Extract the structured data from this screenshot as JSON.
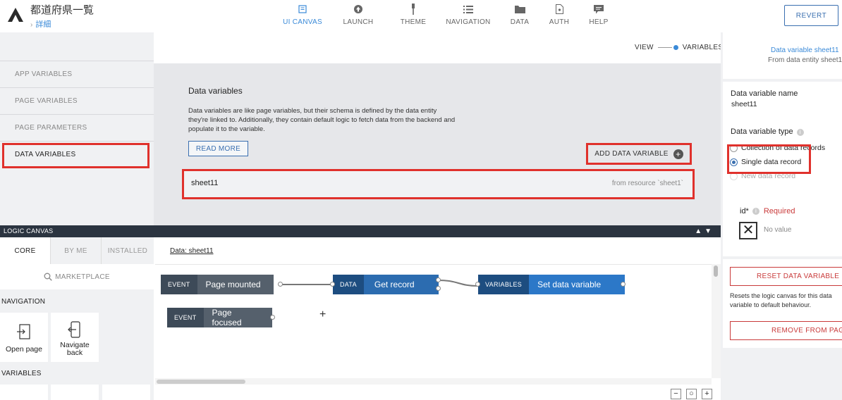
{
  "app": {
    "title": "都道府県一覧",
    "breadcrumb": "詳細"
  },
  "topnav": [
    {
      "label": "UI CANVAS",
      "icon": "ui-canvas-icon",
      "active": true
    },
    {
      "label": "LAUNCH",
      "icon": "launch-icon",
      "active": false
    },
    {
      "label": "THEME",
      "icon": "theme-brush-icon",
      "active": false
    },
    {
      "label": "NAVIGATION",
      "icon": "navigation-list-icon",
      "active": false
    },
    {
      "label": "DATA",
      "icon": "folder-icon",
      "active": false
    },
    {
      "label": "AUTH",
      "icon": "auth-document-icon",
      "active": false
    },
    {
      "label": "HELP",
      "icon": "help-chat-icon",
      "active": false
    }
  ],
  "revert_label": "REVERT",
  "left_menu": [
    {
      "label": "APP VARIABLES"
    },
    {
      "label": "PAGE VARIABLES"
    },
    {
      "label": "PAGE PARAMETERS"
    },
    {
      "label": "DATA VARIABLES",
      "active": true
    }
  ],
  "view_toggle": {
    "left": "VIEW",
    "right": "VARIABLES"
  },
  "data_variables": {
    "title": "Data variables",
    "description": "Data variables are like page variables, but their schema is defined by the data entity they're linked to. Additionally, they contain default logic to fetch data from the backend and populate it to the variable.",
    "read_more": "READ MORE",
    "add_label": "ADD DATA VARIABLE",
    "items": [
      {
        "name": "sheet11",
        "source": "from resource `sheet1`"
      }
    ]
  },
  "logic_canvas": {
    "header": "LOGIC CANVAS",
    "tabs": [
      "CORE",
      "BY ME",
      "INSTALLED"
    ],
    "marketplace": "MARKETPLACE",
    "section_navigation": "NAVIGATION",
    "section_variables": "VARIABLES",
    "tiles": [
      {
        "label": "Open page",
        "icon": "open-page-icon"
      },
      {
        "label": "Navigate back",
        "icon": "navigate-back-icon"
      }
    ],
    "context_link": "Data: sheet11",
    "nodes": [
      {
        "kind": "EVENT",
        "title": "Page mounted"
      },
      {
        "kind": "DATA",
        "title": "Get record"
      },
      {
        "kind": "VARIABLES",
        "title": "Set data variable"
      },
      {
        "kind": "EVENT",
        "title": "Page focused"
      }
    ],
    "zoom": [
      "−",
      "○",
      "+"
    ]
  },
  "right_panel": {
    "header_line1": "Data variable sheet11",
    "header_line2": "From data entity sheet1",
    "name_label": "Data variable name",
    "name_value": "sheet11",
    "type_label": "Data variable type",
    "type_options": [
      {
        "label": "Collection of data records",
        "selected": false
      },
      {
        "label": "Single data record",
        "selected": true
      },
      {
        "label": "New data record",
        "selected": false
      }
    ],
    "id_label": "id*",
    "required_label": "Required",
    "no_value": "No value",
    "reset_label": "RESET DATA VARIABLE LOGIC",
    "reset_note": "Resets the logic canvas for this data variable to default behaviour.",
    "remove_label": "REMOVE FROM PAGE"
  },
  "colors": {
    "accent": "#3a8ad8",
    "highlight": "#e0312c",
    "danger": "#c93a3a",
    "dark_header": "#2b3440"
  }
}
